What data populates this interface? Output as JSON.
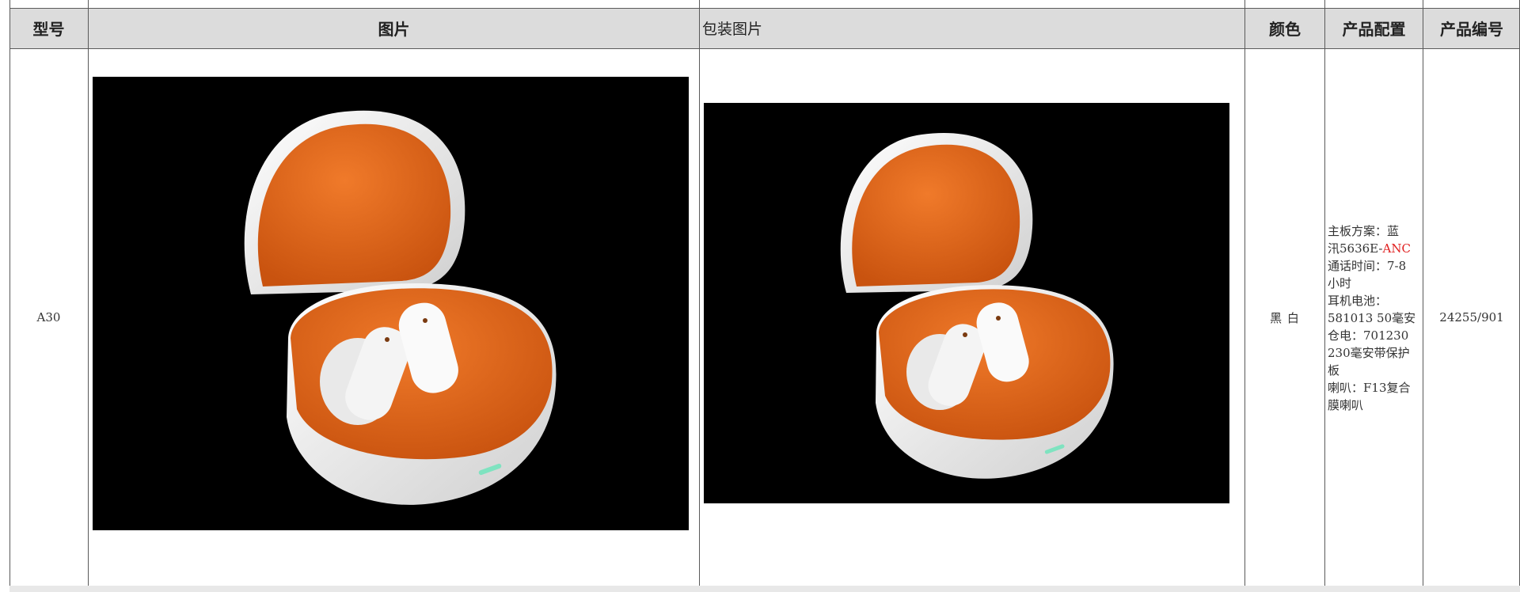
{
  "table": {
    "headers": {
      "model": "型号",
      "image": "图片",
      "package_image": "包装图片",
      "color": "颜色",
      "config": "产品配置",
      "code": "产品编号"
    },
    "rows": [
      {
        "model": "A30",
        "color": "黑 白",
        "code": "24255/901",
        "config": {
          "line1": "主板方案：蓝",
          "line2_prefix": "汛5636E-",
          "line2_accent": "ANC",
          "line3": "通话时间：7-8",
          "line4": "小时",
          "line5": "耳机电池：",
          "line6": "581013 50毫安",
          "line7": "仓电：701230",
          "line8": "230毫安带保护",
          "line9": "板",
          "line10": "喇叭：F13复合",
          "line11": "膜喇叭"
        },
        "product_image": {
          "description_icon": "earbuds-case-open-icon",
          "background": "#000000",
          "case_shell": "#f2f0f0",
          "case_inner": "#e86a1e"
        }
      }
    ]
  },
  "colors": {
    "header_bg": "#dcdcdc",
    "grid": "#5a5a5a",
    "accent": "#e02020"
  }
}
